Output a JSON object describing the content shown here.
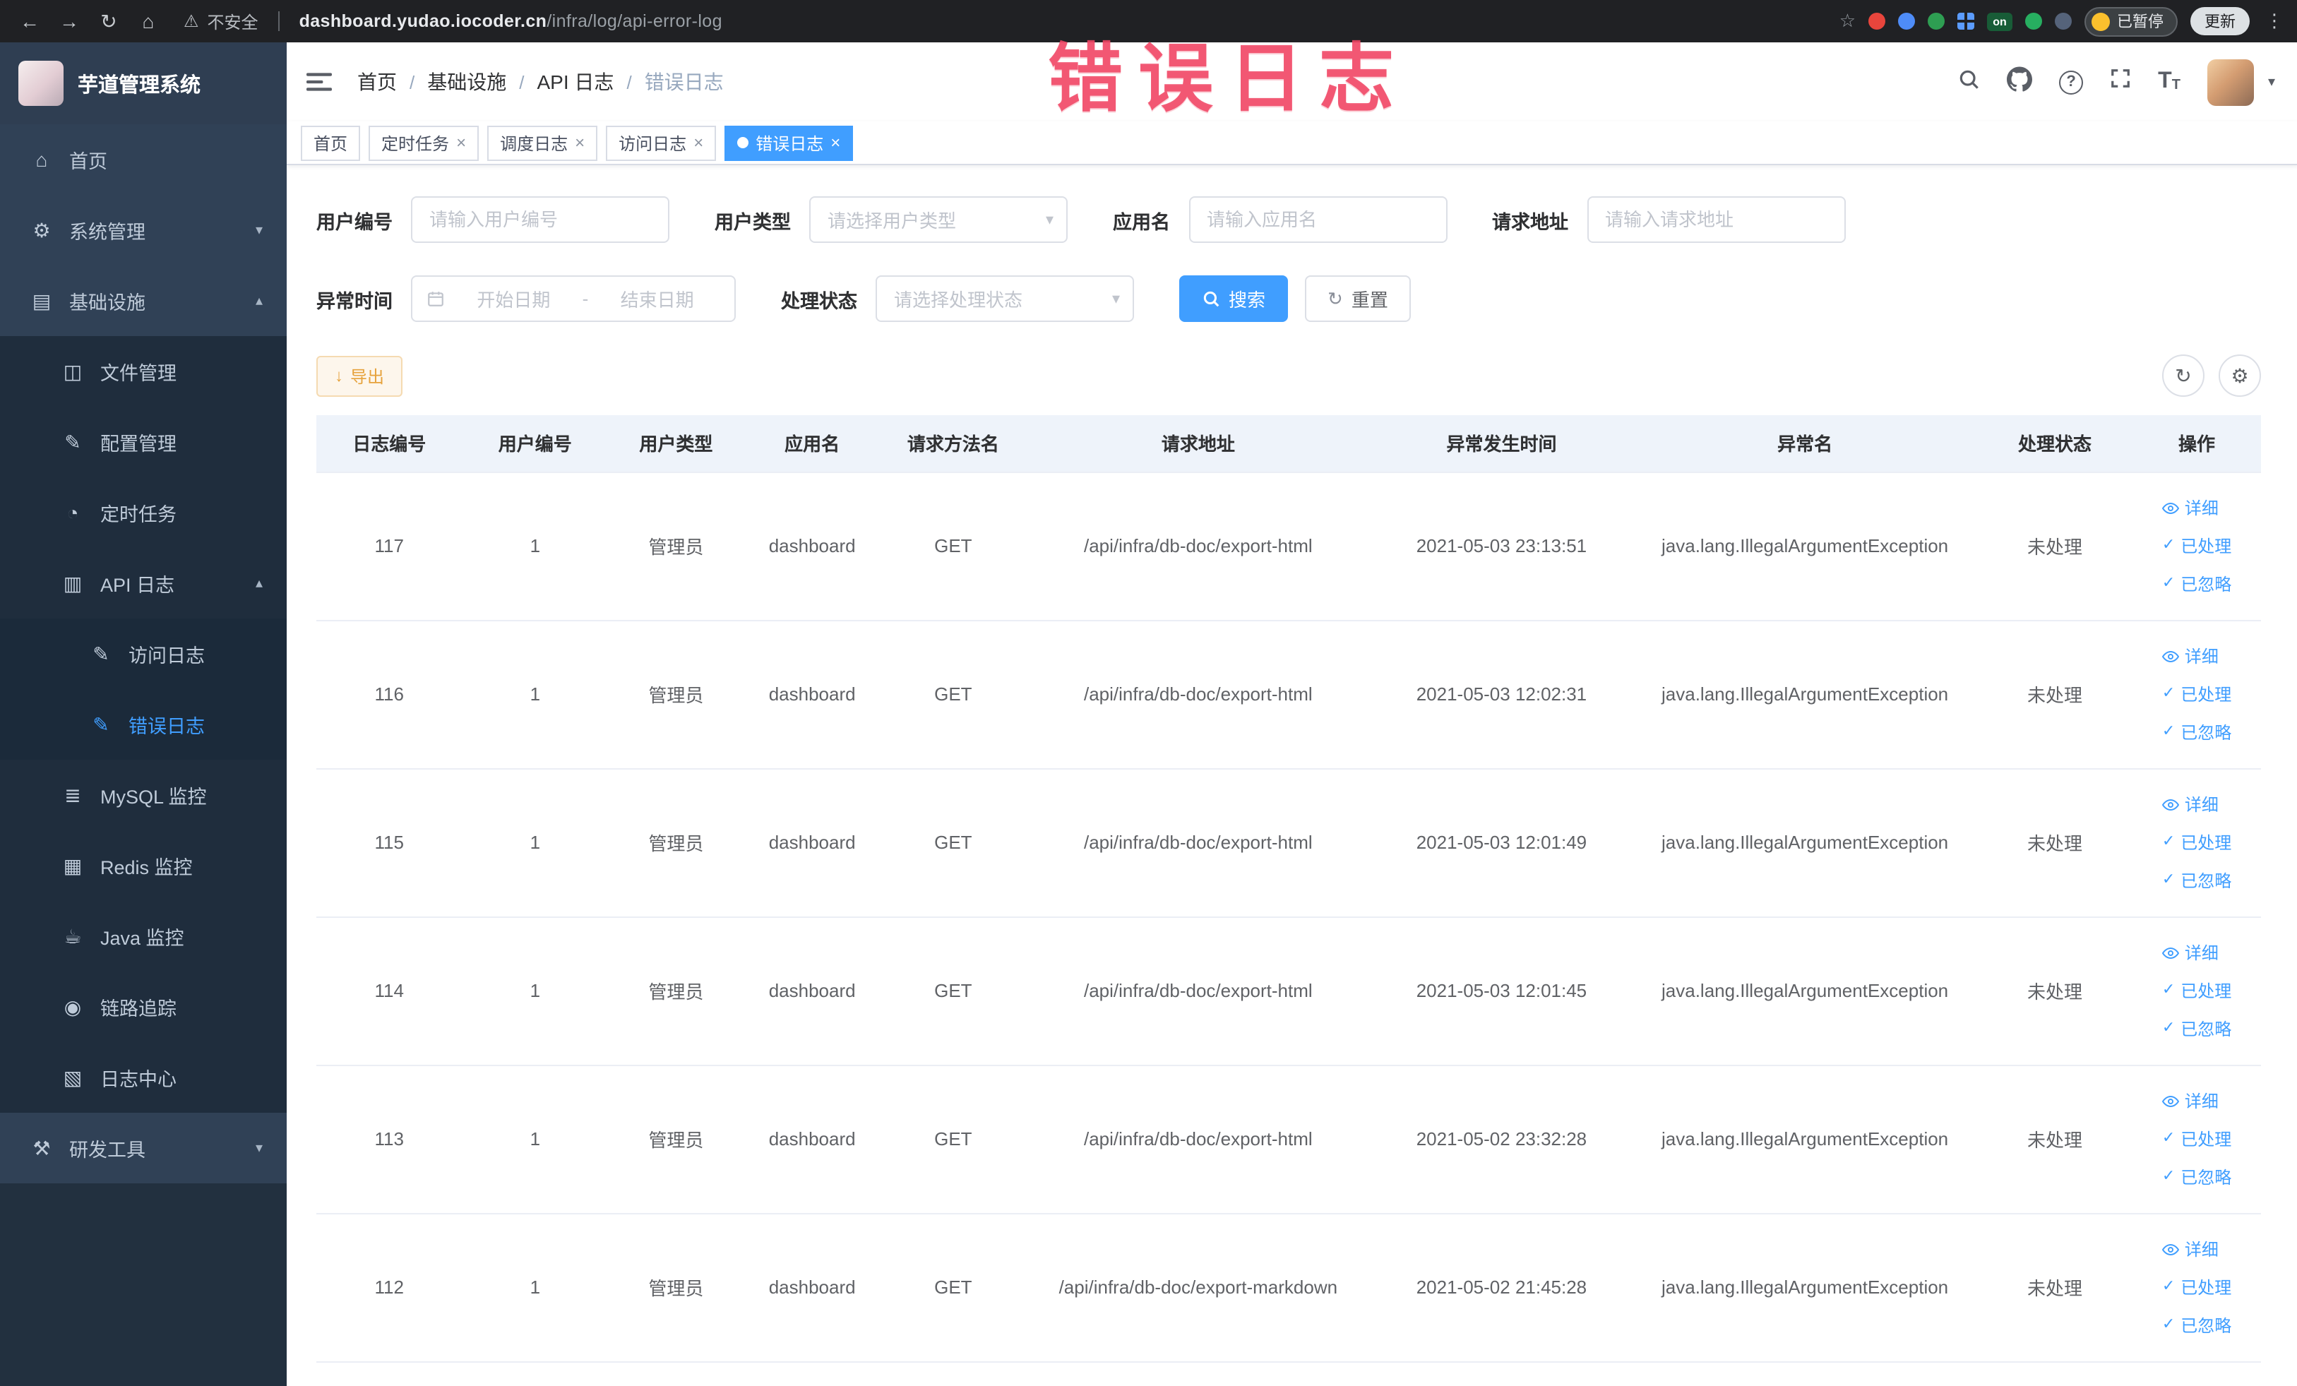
{
  "overlay": {
    "caption": "错误日志"
  },
  "browser": {
    "security_label": "不安全",
    "url_domain": "dashboard.yudao.iocoder.cn",
    "url_path": "/infra/log/api-error-log",
    "extension_badge": "on",
    "paused_badge": "已暂停",
    "update_label": "更新"
  },
  "icons": {
    "back": "←",
    "forward": "→",
    "reload": "↻",
    "home": "⌂",
    "warning": "⚠",
    "star": "☆",
    "kebab": "⋮",
    "question": "?",
    "font_large": "T",
    "font_small": "T",
    "caret_down": "▾",
    "chevron_down": "▾",
    "chevron_up": "▴",
    "close": "×",
    "check": "✓",
    "refresh": "↻",
    "gear": "⚙",
    "download": "↓",
    "separator": "/",
    "menu_home": "⌂",
    "menu_system": "⚙",
    "menu_infra": "▤",
    "menu_file": "◫",
    "menu_config": "✎",
    "menu_task": "◔",
    "menu_apilog": "▥",
    "menu_doc": "✎",
    "menu_mysql": "≣",
    "menu_redis": "▦",
    "menu_java": "☕",
    "menu_trace": "◉",
    "menu_logcenter": "▧",
    "menu_tools": "⚒"
  },
  "sidebar": {
    "logo_title": "芋道管理系统",
    "items": [
      {
        "label": "首页"
      },
      {
        "label": "系统管理"
      },
      {
        "label": "基础设施"
      },
      {
        "label": "文件管理"
      },
      {
        "label": "配置管理"
      },
      {
        "label": "定时任务"
      },
      {
        "label": "API 日志"
      },
      {
        "label": "访问日志"
      },
      {
        "label": "错误日志"
      },
      {
        "label": "MySQL 监控"
      },
      {
        "label": "Redis 监控"
      },
      {
        "label": "Java 监控"
      },
      {
        "label": "链路追踪"
      },
      {
        "label": "日志中心"
      },
      {
        "label": "研发工具"
      }
    ]
  },
  "header": {
    "breadcrumb": [
      "首页",
      "基础设施",
      "API 日志",
      "错误日志"
    ]
  },
  "tabs": [
    {
      "label": "首页",
      "closable": false,
      "active": false
    },
    {
      "label": "定时任务",
      "closable": true,
      "active": false
    },
    {
      "label": "调度日志",
      "closable": true,
      "active": false
    },
    {
      "label": "访问日志",
      "closable": true,
      "active": false
    },
    {
      "label": "错误日志",
      "closable": true,
      "active": true
    }
  ],
  "filters": {
    "user_id": {
      "label": "用户编号",
      "placeholder": "请输入用户编号"
    },
    "user_type": {
      "label": "用户类型",
      "placeholder": "请选择用户类型"
    },
    "app_name": {
      "label": "应用名",
      "placeholder": "请输入应用名"
    },
    "request_url": {
      "label": "请求地址",
      "placeholder": "请输入请求地址"
    },
    "exception_time": {
      "label": "异常时间",
      "start_placeholder": "开始日期",
      "end_placeholder": "结束日期",
      "separator": "-"
    },
    "process_status": {
      "label": "处理状态",
      "placeholder": "请选择处理状态"
    },
    "search_label": "搜索",
    "reset_label": "重置"
  },
  "toolbar": {
    "export_label": "导出"
  },
  "table": {
    "columns": [
      "日志编号",
      "用户编号",
      "用户类型",
      "应用名",
      "请求方法名",
      "请求地址",
      "异常发生时间",
      "异常名",
      "处理状态",
      "操作"
    ],
    "actions": [
      "详细",
      "已处理",
      "已忽略"
    ],
    "rows": [
      {
        "id": "117",
        "user_id": "1",
        "user_type": "管理员",
        "app": "dashboard",
        "method": "GET",
        "url": "/api/infra/db-doc/export-html",
        "time": "2021-05-03 23:13:51",
        "exception": "java.lang.IllegalArgumentException",
        "status": "未处理"
      },
      {
        "id": "116",
        "user_id": "1",
        "user_type": "管理员",
        "app": "dashboard",
        "method": "GET",
        "url": "/api/infra/db-doc/export-html",
        "time": "2021-05-03 12:02:31",
        "exception": "java.lang.IllegalArgumentException",
        "status": "未处理"
      },
      {
        "id": "115",
        "user_id": "1",
        "user_type": "管理员",
        "app": "dashboard",
        "method": "GET",
        "url": "/api/infra/db-doc/export-html",
        "time": "2021-05-03 12:01:49",
        "exception": "java.lang.IllegalArgumentException",
        "status": "未处理"
      },
      {
        "id": "114",
        "user_id": "1",
        "user_type": "管理员",
        "app": "dashboard",
        "method": "GET",
        "url": "/api/infra/db-doc/export-html",
        "time": "2021-05-03 12:01:45",
        "exception": "java.lang.IllegalArgumentException",
        "status": "未处理"
      },
      {
        "id": "113",
        "user_id": "1",
        "user_type": "管理员",
        "app": "dashboard",
        "method": "GET",
        "url": "/api/infra/db-doc/export-html",
        "time": "2021-05-02 23:32:28",
        "exception": "java.lang.IllegalArgumentException",
        "status": "未处理"
      },
      {
        "id": "112",
        "user_id": "1",
        "user_type": "管理员",
        "app": "dashboard",
        "method": "GET",
        "url": "/api/infra/db-doc/export-markdown",
        "time": "2021-05-02 21:45:28",
        "exception": "java.lang.IllegalArgumentException",
        "status": "未处理"
      }
    ]
  }
}
